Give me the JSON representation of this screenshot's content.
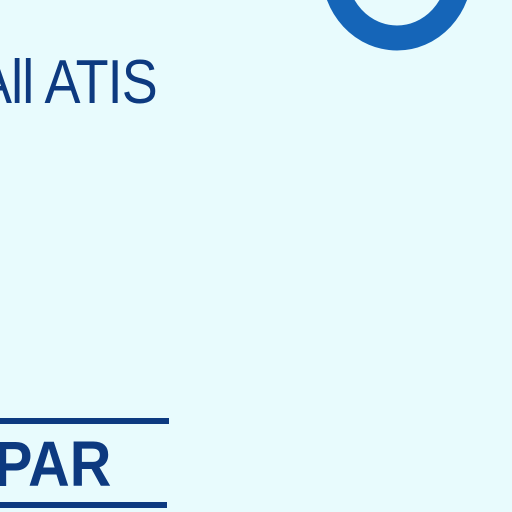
{
  "chart": {
    "label_atis": "All ATIS",
    "label_par": "PAR",
    "symbol": "airport-ring-symbol",
    "colors": {
      "background": "#e8fbfd",
      "text": "#0d3a80",
      "symbol": "#1565b8"
    }
  }
}
